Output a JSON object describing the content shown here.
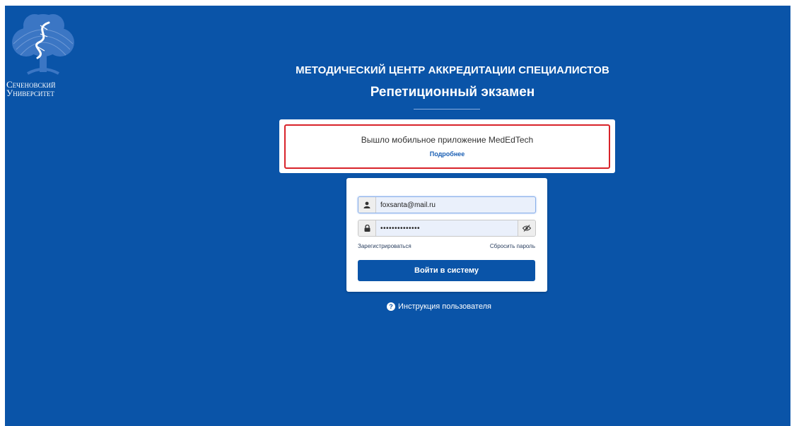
{
  "logo": {
    "name_line1": "Сеченовский",
    "name_line2": "Университет",
    "icon": "dna-tree-icon"
  },
  "header": {
    "title": "МЕТОДИЧЕСКИЙ ЦЕНТР АККРЕДИТАЦИИ СПЕЦИАЛИСТОВ",
    "subtitle": "Репетиционный экзамен"
  },
  "notice": {
    "text": "Вышло мобильное приложение MedEdTech",
    "link": "Подробнее"
  },
  "login": {
    "email_value": "foxsanta@mail.ru",
    "password_value": "••••••••••••••",
    "user_icon": "user-icon",
    "lock_icon": "lock-icon",
    "eye_icon": "eye-toggle-icon",
    "register_link": "Зарегистрироваться",
    "reset_link": "Сбросить пароль",
    "submit_label": "Войти в систему"
  },
  "help": {
    "icon": "question-circle-icon",
    "label": "Инструкция пользователя"
  },
  "colors": {
    "page_background": "#0a54a8",
    "button": "#0a54a8",
    "notice_border": "#d8232a"
  }
}
